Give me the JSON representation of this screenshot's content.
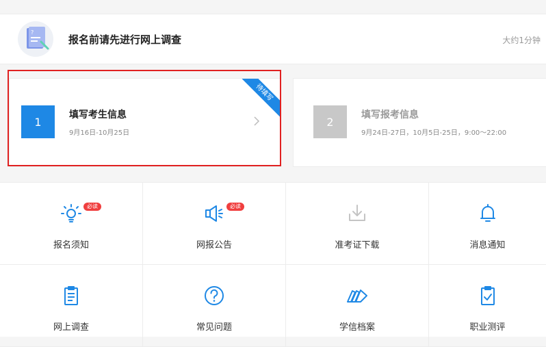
{
  "survey": {
    "title": "报名前请先进行网上调查",
    "duration": "大约1分钟"
  },
  "steps": [
    {
      "number": "1",
      "title": "填写考生信息",
      "dates": "9月16日-10月25日",
      "ribbon": "待填写"
    },
    {
      "number": "2",
      "title": "填写报考信息",
      "dates": "9月24日-27日，10月5日-25日，9:00～22:00"
    }
  ],
  "grid": [
    {
      "label": "报名须知",
      "icon": "lightbulb-icon",
      "badge": "必读"
    },
    {
      "label": "网报公告",
      "icon": "megaphone-icon",
      "badge": "必读"
    },
    {
      "label": "准考证下载",
      "icon": "download-icon"
    },
    {
      "label": "消息通知",
      "icon": "bell-icon"
    },
    {
      "label": "网上调查",
      "icon": "clipboard-icon"
    },
    {
      "label": "常见问题",
      "icon": "question-icon"
    },
    {
      "label": "学信档案",
      "icon": "books-icon"
    },
    {
      "label": "职业测评",
      "icon": "clipboard-check-icon"
    }
  ],
  "colors": {
    "accent": "#1e88e5",
    "badge": "#f03e3e",
    "highlight": "#e02020",
    "disabled": "#c8c8c8"
  }
}
